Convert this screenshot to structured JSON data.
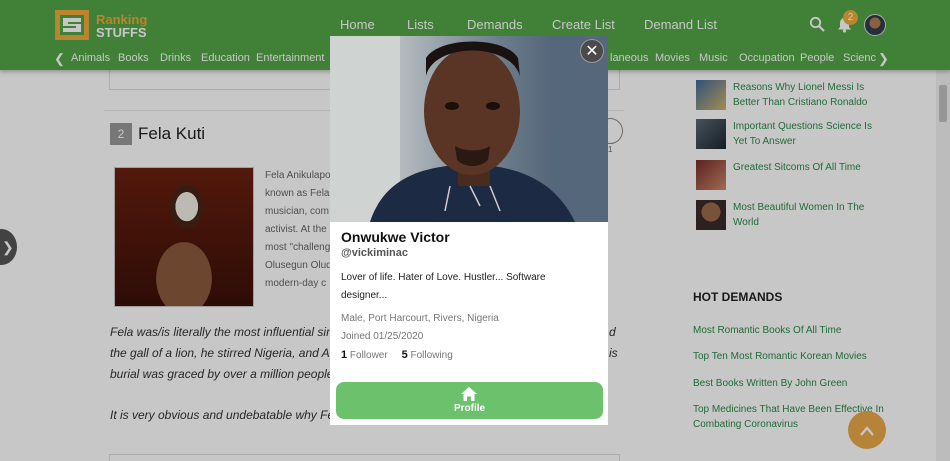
{
  "logo": {
    "word1": "Ranking",
    "word2": "STUFFS"
  },
  "nav": {
    "home": "Home",
    "lists": "Lists",
    "demands": "Demands",
    "create_list": "Create List",
    "demand_list": "Demand List"
  },
  "header": {
    "notification_count": "2"
  },
  "categories": [
    "Animals",
    "Books",
    "Drinks",
    "Education",
    "Entertainment",
    "laneous",
    "Movies",
    "Music",
    "Occupation",
    "People",
    "Scienc"
  ],
  "item": {
    "rank": "2",
    "title": "Fela Kuti",
    "vote_count": "1",
    "description_lines": [
      "Fela Anikulapo",
      "known as Fela",
      "musician, com",
      "activist. At the",
      "most \"challeng",
      "Olusegun Olud",
      "modern-day c"
    ],
    "quote_lines": [
      "Fela was/is literally the most influential sin",
      "the gall of a lion, he stirred Nigeria, and Afr",
      "burial was graced by over a million people."
    ],
    "quote_right": [
      "d",
      "is"
    ],
    "quote2": "It is very obvious and undebatable why Fela"
  },
  "sidebar": {
    "lists": [
      {
        "title": "Reasons Why Lionel Messi Is Better Than Cristiano Ronaldo"
      },
      {
        "title": "Important Questions Science Is Yet To Answer"
      },
      {
        "title": "Greatest Sitcoms Of All Time"
      },
      {
        "title": "Most Beautiful Women In The World"
      }
    ],
    "hot_title": "HOT DEMANDS",
    "demands": [
      "Most Romantic Books Of All Time",
      "Top Ten Most Romantic Korean Movies",
      "Best Books Written By John Green",
      "Top Medicines That Have Been Effective In Combating Coronavirus"
    ]
  },
  "profile": {
    "name": "Onwukwe Victor",
    "handle": "@vickiminac",
    "bio": "Lover of life. Hater of Love. Hustler... Software designer...",
    "location": "Male, Port Harcourt, Rivers, Nigeria",
    "joined": "Joined 01/25/2020",
    "followers_count": "1",
    "followers_label": "Follower",
    "following_count": "5",
    "following_label": "Following",
    "button_label": "Profile",
    "close_glyph": "✕"
  },
  "colors": {
    "header_bg": "#52a447",
    "accent_orange": "#f0a93b",
    "link_green": "#2a8a4a",
    "button_green": "#6cc26c"
  }
}
